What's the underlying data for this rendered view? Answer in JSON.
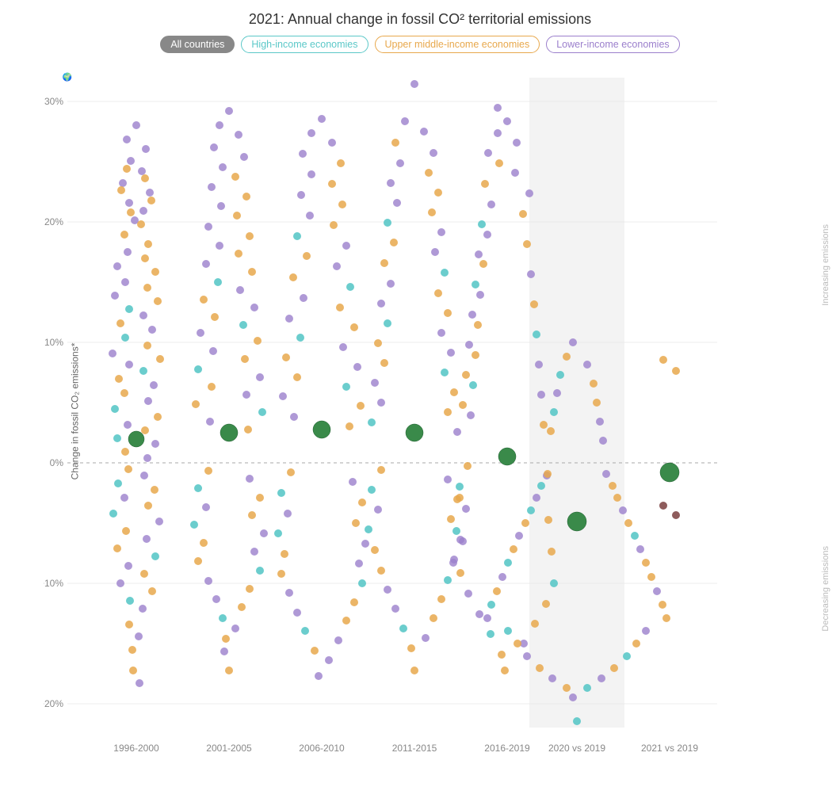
{
  "title": "2021: Annual change in fossil CO² territorial emissions",
  "legend": {
    "items": [
      {
        "id": "all-countries",
        "label": "All countries",
        "type": "all-countries"
      },
      {
        "id": "high-income",
        "label": "High-income economies",
        "type": "high-income"
      },
      {
        "id": "upper-middle",
        "label": "Upper middle-income economies",
        "type": "upper-middle"
      },
      {
        "id": "lower-income",
        "label": "Lower-income economies",
        "type": "lower-income"
      }
    ]
  },
  "yAxisLabel": "Change in fossil CO₂ emissions*",
  "rightLabelIncreasing": "Increasing emissions",
  "rightLabelDecreasing": "Decreasing emissions",
  "xLabels": [
    "1996-2000",
    "2001-2005",
    "2006-2010",
    "2011-2015",
    "2016-2019",
    "2020 vs 2019",
    "2021 vs 2019"
  ],
  "yTicks": [
    "30%",
    "20%",
    "10%",
    "0%",
    "-10%",
    "-20%"
  ],
  "colors": {
    "cyan": "#5bc8c8",
    "orange": "#e8a84c",
    "purple": "#9b7fcc",
    "worldGreen": "#3a8a4a"
  }
}
